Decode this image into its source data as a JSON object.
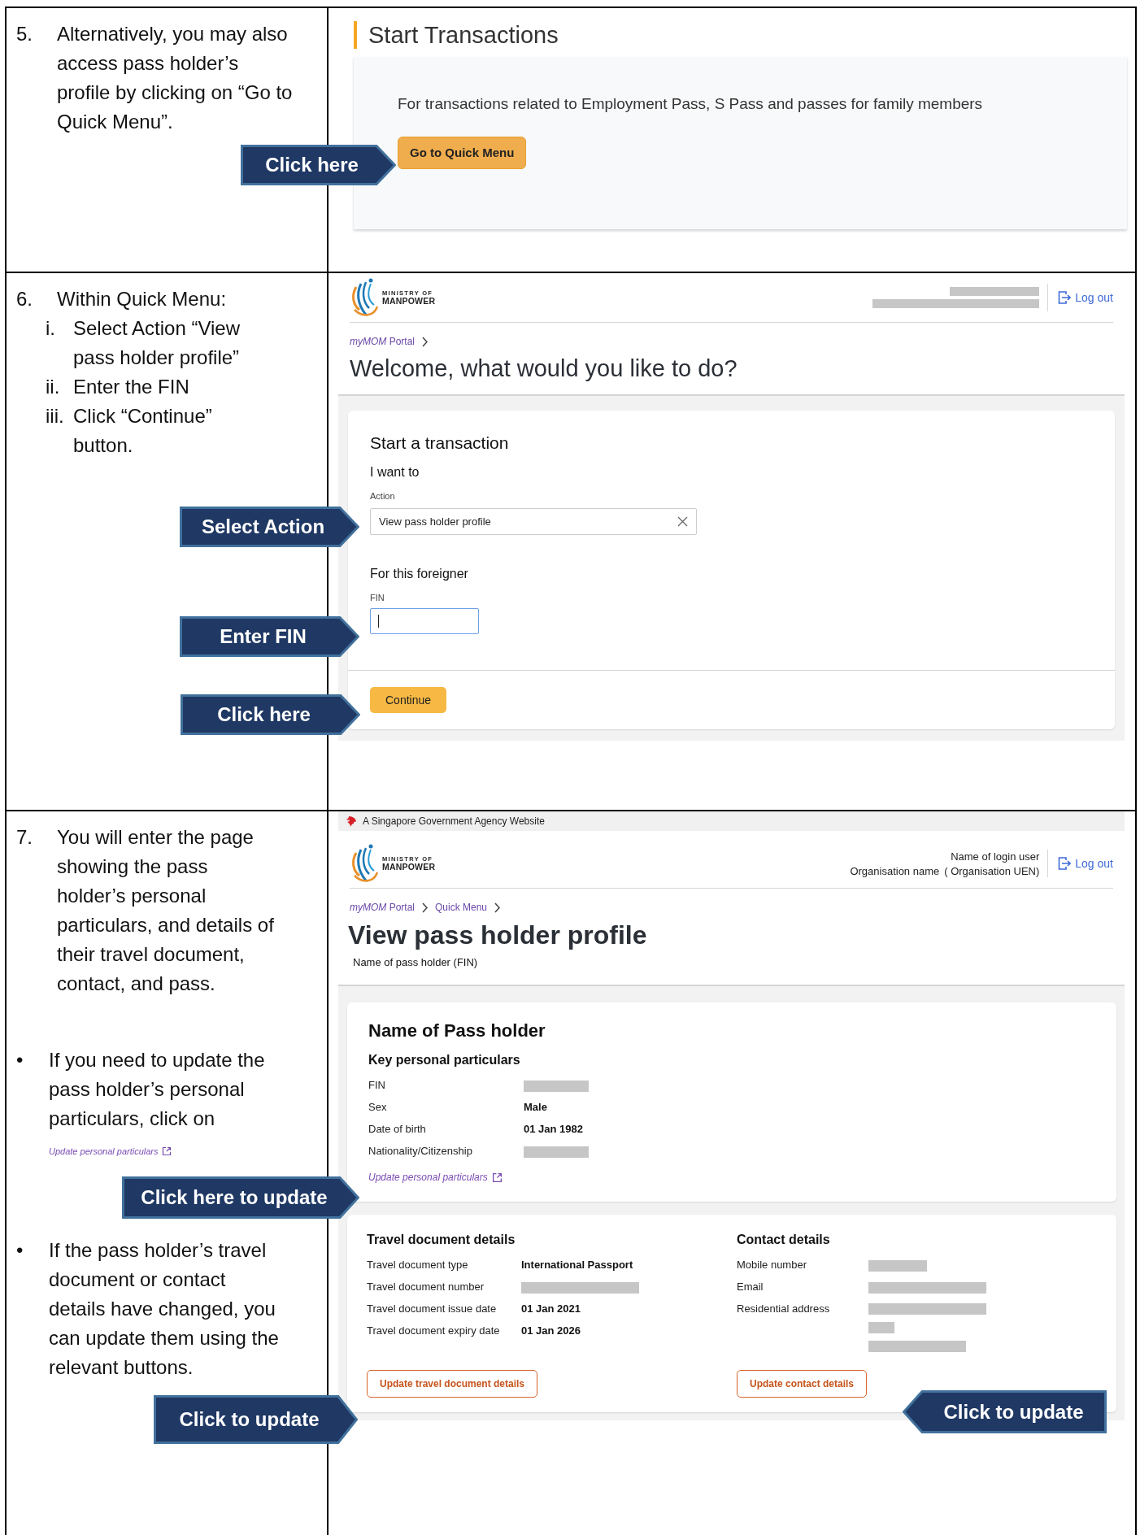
{
  "steps": [
    {
      "number": "5.",
      "text": "Alternatively, you may also access pass holder’s profile by clicking on “Go to Quick Menu”.",
      "callouts": [
        {
          "text": "Click here",
          "kind": "rightward"
        }
      ],
      "screen": {
        "kind": "start-transactions",
        "heading": "Start Transactions",
        "description": "For transactions related to Employment Pass, S Pass and passes for family members",
        "button": "Go to Quick Menu"
      }
    },
    {
      "number": "6.",
      "text": "Within Quick Menu:",
      "sub_items": [
        {
          "marker": "i.",
          "text": "Select Action “View pass holder profile”"
        },
        {
          "marker": "ii.",
          "text": "Enter the FIN"
        },
        {
          "marker": "iii.",
          "text": "Click “Continue” button."
        }
      ],
      "callouts": [
        {
          "text": "Select Action",
          "kind": "rightward"
        },
        {
          "text": "Enter FIN",
          "kind": "rightward"
        },
        {
          "text": "Click here",
          "kind": "rightward"
        }
      ],
      "screen": {
        "kind": "quick-menu",
        "header": {
          "logo_line_1": "MINISTRY OF",
          "logo_line_2": "MANPOWER",
          "user_info": {
            "kind": "redacted"
          },
          "logout": "Log out"
        },
        "breadcrumbs": [
          "*myMOM* Portal"
        ],
        "title": "Welcome, what would you like to do?",
        "card": {
          "title": "Start a transaction",
          "section_1": "I want to",
          "action_label": "Action",
          "action_value": "View pass holder profile",
          "section_2": "For this foreigner",
          "fin_label": "FIN",
          "fin_focused": true,
          "button": "Continue"
        }
      }
    },
    {
      "number": "7.",
      "text": "You will enter the page showing the pass holder’s personal particulars, and details of their travel document, contact, and pass.",
      "bullets": [
        {
          "marker": "•",
          "text": "If you need to update the pass holder’s personal particulars, click on",
          "link": "Update personal particulars"
        },
        {
          "marker": "•",
          "text": "If the pass holder’s travel document or contact details have changed, you can update them using the relevant buttons."
        }
      ],
      "callouts": [
        {
          "text": "Click here to update",
          "kind": "rightward"
        },
        {
          "text": "Click to update",
          "kind": "rightward"
        },
        {
          "text": "Click to update",
          "kind": "leftward"
        }
      ],
      "screen": {
        "kind": "profile",
        "gov_banner": "A Singapore Government Agency Website",
        "header": {
          "logo_line_1": "MINISTRY OF",
          "logo_line_2": "MANPOWER",
          "user_info": {
            "kind": "text",
            "name": "Name of login user",
            "organisation": "Organisation name",
            "uen": "( Organisation UEN)"
          },
          "logout": "Log out"
        },
        "breadcrumbs": [
          "*myMOM* Portal",
          "Quick Menu"
        ],
        "title": "View pass holder profile",
        "subtitle": "Name of pass holder (FIN)",
        "profile_card": {
          "title": "Name of Pass holder",
          "section": "Key personal particulars",
          "fields": [
            {
              "label": "FIN",
              "kind": "redacted"
            },
            {
              "label": "Sex",
              "kind": "text",
              "value": "Male"
            },
            {
              "label": "Date of birth",
              "kind": "text",
              "value": "01 Jan 1982"
            },
            {
              "label": "Nationality/Citizenship",
              "kind": "redacted"
            }
          ],
          "link": "Update personal particulars"
        },
        "details": [
          {
            "title": "Travel document details",
            "fields": [
              {
                "label": "Travel document type",
                "kind": "text",
                "value": "International Passport"
              },
              {
                "label": "Travel document number",
                "kind": "redacted"
              },
              {
                "label": "Travel document issue date",
                "kind": "text",
                "value": "01 Jan 2021"
              },
              {
                "label": "Travel document expiry date",
                "kind": "text",
                "value": "01 Jan 2026"
              }
            ],
            "button": "Update travel document details"
          },
          {
            "title": "Contact details",
            "fields": [
              {
                "label": "Mobile number",
                "kind": "redacted"
              },
              {
                "label": "Email",
                "kind": "redacted"
              },
              {
                "label": "Residential address",
                "kind": "redacted-multiline"
              }
            ],
            "button": "Update contact details"
          }
        ]
      }
    }
  ]
}
